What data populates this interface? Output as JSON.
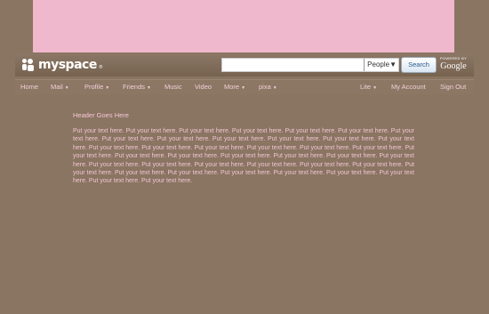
{
  "colors": {
    "background": "#8a7462",
    "banner": "#f0b8cc",
    "text": "#f0c6d3"
  },
  "logo": {
    "text": "myspace",
    "tm": "®"
  },
  "search": {
    "value": "",
    "scope": "People▼",
    "button": "Search"
  },
  "google": {
    "powered_by": "POWERED BY",
    "name": "Google"
  },
  "nav": {
    "left": [
      {
        "label": "Home",
        "dropdown": false
      },
      {
        "label": "Mail",
        "dropdown": true
      },
      {
        "label": "Profile",
        "dropdown": true
      },
      {
        "label": "Friends",
        "dropdown": true
      },
      {
        "label": "Music",
        "dropdown": false
      },
      {
        "label": "Video",
        "dropdown": false
      },
      {
        "label": "More",
        "dropdown": true
      },
      {
        "label": "pixa",
        "dropdown": true
      }
    ],
    "right": [
      {
        "label": "Lite",
        "dropdown": true
      },
      {
        "label": "My Account",
        "dropdown": false
      },
      {
        "label": "Sign Out",
        "dropdown": false
      }
    ],
    "arrow": "▼"
  },
  "content": {
    "header": "Header Goes Here",
    "body": "Put your text here. Put your text here. Put your text here. Put your text here. Put your text here. Put your text here. Put your text here. Put your text here. Put your text here. Put your text here. Put your text here. Put your text here. Put your text here. Put your text here. Put your text here. Put your text here. Put your text here. Put your text here. Put your text here. Put your text here. Put your text here. Put your text here. Put your text here. Put your text here. Put your text here. Put your text here. Put your text here. Put your text here. Put your text here. Put your text here. Put your text here. Put your text here. Put your text here. Put your text here. Put your text here. Put your text here. Put your text here. Put your text here. Put your text here. Put your text here. Put your text here."
  }
}
